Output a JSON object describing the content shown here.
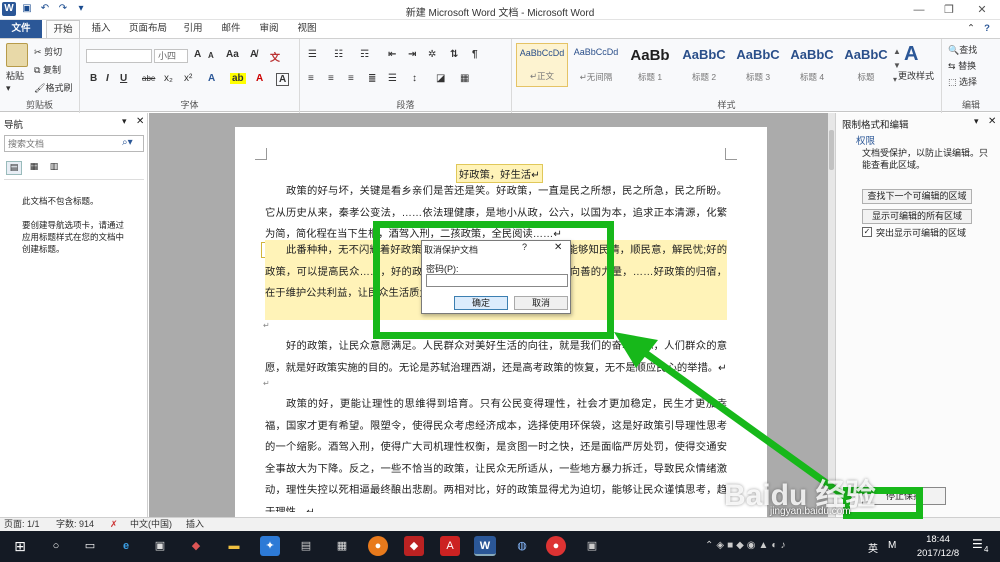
{
  "window": {
    "title": "新建 Microsoft Word 文档 - Microsoft Word",
    "help": "?"
  },
  "tabs": [
    "文件",
    "开始",
    "插入",
    "页面布局",
    "引用",
    "邮件",
    "审阅",
    "视图"
  ],
  "ribbon": {
    "clipboard": {
      "paste": "粘贴",
      "cut": "剪切",
      "copy": "复制",
      "format_painter": "格式刷",
      "label": "剪贴板"
    },
    "font": {
      "size": "小四",
      "label": "字体",
      "bold": "B",
      "italic": "I",
      "underline": "U",
      "strike": "abe",
      "sub": "x₂",
      "sup": "x²",
      "grow": "A",
      "shrink": "A"
    },
    "paragraph": {
      "label": "段落"
    },
    "styles": {
      "label": "样式",
      "items": [
        {
          "preview": "AaBbCcDd",
          "name": "↵正文"
        },
        {
          "preview": "AaBbCcDd",
          "name": "↵无间隔"
        },
        {
          "preview": "AaBb",
          "name": "标题 1"
        },
        {
          "preview": "AaBbC",
          "name": "标题 2"
        },
        {
          "preview": "AaBbC",
          "name": "标题 3"
        },
        {
          "preview": "AaBbC",
          "name": "标题 4"
        },
        {
          "preview": "AaBbC",
          "name": "标题"
        }
      ],
      "change_styles": "更改样式"
    },
    "editing": {
      "find": "查找",
      "replace": "替换",
      "select": "选择",
      "label": "编辑"
    }
  },
  "nav": {
    "title": "导航",
    "search_placeholder": "搜索文档",
    "msg1": "此文档不包含标题。",
    "msg2": "要创建导航选项卡，请通过应用标题样式在您的文档中创建标题。"
  },
  "document": {
    "heading": "好政策，好生活↵",
    "p1": "政策的好与坏，关键是看乡亲们是苦还是笑。好政策，一直是民之所想，民之所急，民之所盼。它从历史从来，秦孝公变法，……依法理健康，是地小从政，公六，以国为本，追求正本清源，化繁为简，简化程在当下生根，酒驾入刑，二孩政策，全民阅读……↵",
    "p2": "此番种种，无不闪耀着好政策的光芒……，人民群众获得感，能够知民情，顺民意，解民忧;好的政策，可以提高民众……，好的政策，助于提高公民的德性，培育向善的力量，……好政策的归宿，在于维护公共利益，让民众生活质量更美好。因此……",
    "p3": "好的政策，让民众意愿满足。人民群众对美好生活的向往，就是我们的奋斗目标，人们群众的意愿，就是好政策实施的目的。无论是苏轼治理西湖，还是高考政策的恢复，无不是顺应民心的举措。↵",
    "p4": "政策的好，更能让理性的思维得到培育。只有公民变得理性，社会才更加稳定，民生才更加幸福，国家才更有希望。限塑令，使得民众考虑经济成本，选择使用环保袋，这是好政策引导理性思考的一个缩影。酒驾入刑，使得广大司机理性权衡，是贪图一时之快，还是面临严厉处罚，使得交通安全事故大为下降。反之，一些不恰当的政策，让民众无所适从，一些地方暴力拆迁，导致民众情绪激动，理性失控以死相逼最终酿出悲剧。两相对比，好的政策显得尤为迫切，能够让民众谨慎思考，趋于理性。↵",
    "ret": "↵"
  },
  "restrict": {
    "title": "限制格式和编辑",
    "section": "权限",
    "desc": "文档受保护，以防止误编辑。只能查看此区域。",
    "btn_next": "查找下一个可编辑的区域",
    "btn_all": "显示可编辑的所有区域",
    "check_label": "突出显示可编辑的区域",
    "stop_button": "停止保护"
  },
  "dialog": {
    "title": "取消保护文档",
    "help": "?",
    "label": "密码(P):",
    "password": "",
    "ok": "确定",
    "cancel": "取消"
  },
  "status": {
    "page": "页面: 1/1",
    "words": "字数: 914",
    "lang": "中文(中国)",
    "mode": "插入"
  },
  "taskbar": {
    "time": "18:44",
    "date": "2017/12/8",
    "ime": "英",
    "ime2": "M",
    "notif": "4"
  },
  "watermark": "Baidu 经验",
  "watermark_url": "jingyan.baidu.com"
}
